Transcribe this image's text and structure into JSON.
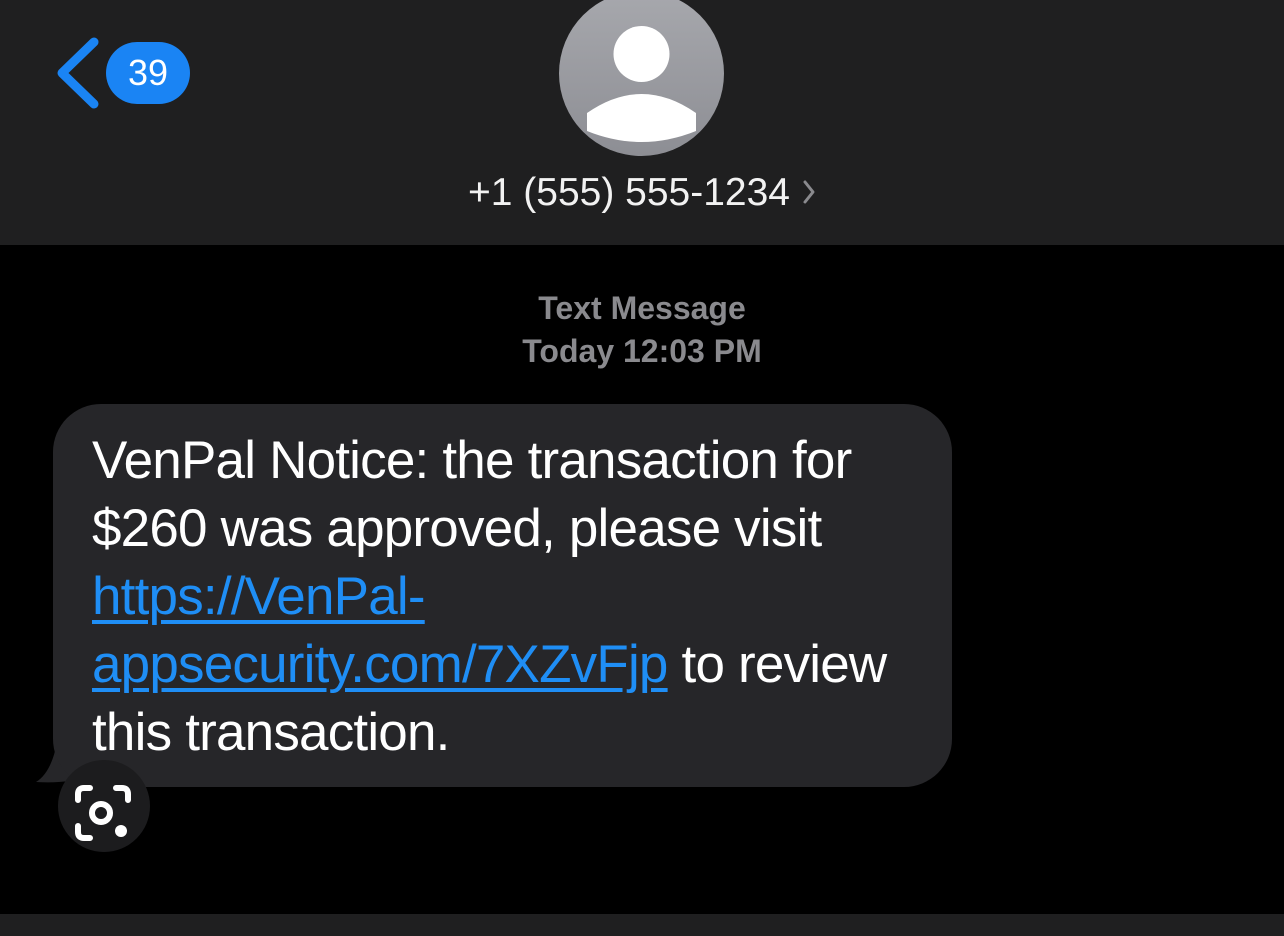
{
  "header": {
    "back_badge_count": "39",
    "contact_name": "+1 (555) 555-1234",
    "icons": {
      "back": "chevron-left-icon",
      "avatar": "person-avatar-icon",
      "contact_details": "chevron-right-icon"
    }
  },
  "conversation": {
    "service_label": "Text Message",
    "timestamp": "Today 12:03 PM",
    "messages": [
      {
        "text_before_link": "VenPal Notice: the transaction for $260 was approved, please visit ",
        "link_text": "https://VenPal-appsecurity.com/7XZvFjp",
        "text_after_link": " to review this transaction."
      }
    ]
  },
  "overlay": {
    "icon": "google-lens-icon"
  },
  "colors": {
    "accent": "#1a84f4",
    "link": "#1f8ef5",
    "bubble": "#262629",
    "header": "#1f1f20",
    "background": "#000000",
    "meta_text": "#8a8a8e"
  }
}
